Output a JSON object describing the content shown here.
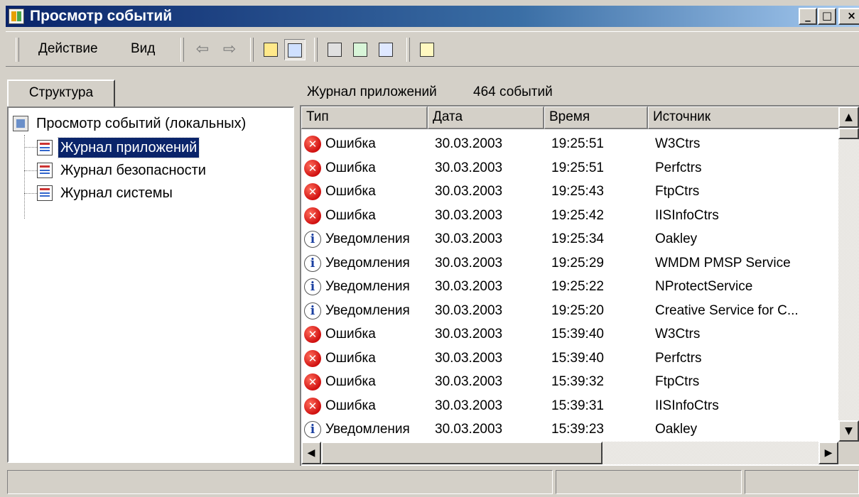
{
  "window": {
    "title": "Просмотр событий",
    "controls": {
      "minimize": "_",
      "maximize": "□",
      "close": "×"
    }
  },
  "toolbar": {
    "menu": {
      "action": "Действие",
      "view": "Вид"
    },
    "icons": [
      "back-arrow-icon",
      "forward-arrow-icon",
      "up-folder-icon",
      "show-hide-tree-icon",
      "properties-icon",
      "refresh-icon",
      "export-list-icon",
      "help-icon"
    ]
  },
  "left_pane": {
    "tab_label": "Структура",
    "tree": {
      "root": "Просмотр событий (локальных)",
      "children": [
        "Журнал приложений",
        "Журнал безопасности",
        "Журнал системы"
      ],
      "selected": "Журнал приложений"
    }
  },
  "right_pane": {
    "title": "Журнал приложений",
    "count": "464 событий",
    "columns": [
      "Тип",
      "Дата",
      "Время",
      "Источник"
    ],
    "rows": [
      {
        "type": "Ошибка",
        "kind": "error",
        "date": "30.03.2003",
        "time": "19:25:51",
        "source": "W3Ctrs"
      },
      {
        "type": "Ошибка",
        "kind": "error",
        "date": "30.03.2003",
        "time": "19:25:51",
        "source": "Perfctrs"
      },
      {
        "type": "Ошибка",
        "kind": "error",
        "date": "30.03.2003",
        "time": "19:25:43",
        "source": "FtpCtrs"
      },
      {
        "type": "Ошибка",
        "kind": "error",
        "date": "30.03.2003",
        "time": "19:25:42",
        "source": "IISInfoCtrs"
      },
      {
        "type": "Уведомления",
        "kind": "info",
        "date": "30.03.2003",
        "time": "19:25:34",
        "source": "Oakley"
      },
      {
        "type": "Уведомления",
        "kind": "info",
        "date": "30.03.2003",
        "time": "19:25:29",
        "source": "WMDM PMSP Service"
      },
      {
        "type": "Уведомления",
        "kind": "info",
        "date": "30.03.2003",
        "time": "19:25:22",
        "source": "NProtectService"
      },
      {
        "type": "Уведомления",
        "kind": "info",
        "date": "30.03.2003",
        "time": "19:25:20",
        "source": "Creative Service for C..."
      },
      {
        "type": "Ошибка",
        "kind": "error",
        "date": "30.03.2003",
        "time": "15:39:40",
        "source": "W3Ctrs"
      },
      {
        "type": "Ошибка",
        "kind": "error",
        "date": "30.03.2003",
        "time": "15:39:40",
        "source": "Perfctrs"
      },
      {
        "type": "Ошибка",
        "kind": "error",
        "date": "30.03.2003",
        "time": "15:39:32",
        "source": "FtpCtrs"
      },
      {
        "type": "Ошибка",
        "kind": "error",
        "date": "30.03.2003",
        "time": "15:39:31",
        "source": "IISInfoCtrs"
      },
      {
        "type": "Уведомления",
        "kind": "info",
        "date": "30.03.2003",
        "time": "15:39:23",
        "source": "Oakley"
      }
    ]
  },
  "scroll": {
    "up": "▲",
    "down": "▼",
    "left": "◀",
    "right": "▶"
  },
  "colors": {
    "title_bar": "#0a246a",
    "selection": "#0a246a",
    "face": "#d4d0c8",
    "error": "#d01010",
    "info": "#1a3fa0"
  }
}
